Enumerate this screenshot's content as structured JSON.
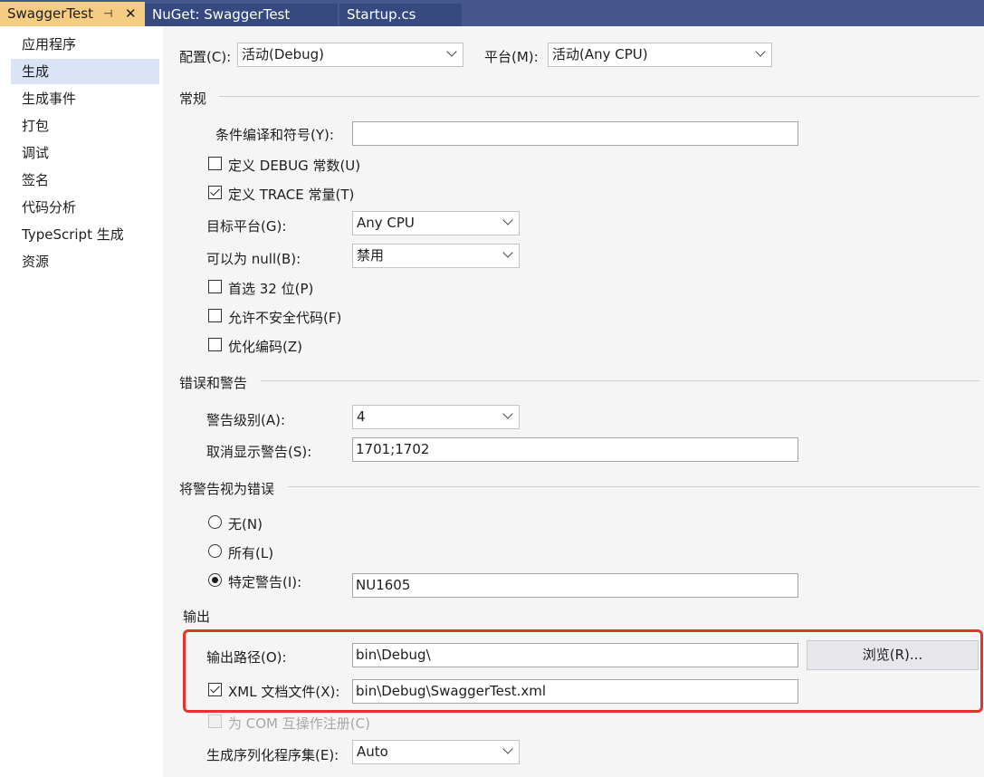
{
  "tabs": [
    {
      "label": "SwaggerTest",
      "pin": "⊣",
      "close": "✕"
    },
    {
      "label": "NuGet: SwaggerTest"
    },
    {
      "label": "Startup.cs"
    }
  ],
  "sidebar": {
    "items": [
      {
        "label": "应用程序"
      },
      {
        "label": "生成"
      },
      {
        "label": "生成事件"
      },
      {
        "label": "打包"
      },
      {
        "label": "调试"
      },
      {
        "label": "签名"
      },
      {
        "label": "代码分析"
      },
      {
        "label": "TypeScript 生成"
      },
      {
        "label": "资源"
      }
    ],
    "selected": "生成"
  },
  "header": {
    "config_label": "配置(C):",
    "config_value": "活动(Debug)",
    "platform_label": "平台(M):",
    "platform_value": "活动(Any CPU)"
  },
  "general": {
    "title": "常规",
    "symbols_label": "条件编译和符号(Y):",
    "symbols_value": "",
    "define_debug_label": "定义 DEBUG 常数(U)",
    "define_debug_checked": false,
    "define_trace_label": "定义 TRACE 常量(T)",
    "define_trace_checked": true,
    "target_label": "目标平台(G):",
    "target_value": "Any CPU",
    "nullable_label": "可以为 null(B):",
    "nullable_value": "禁用",
    "prefer32_label": "首选 32 位(P)",
    "unsafe_label": "允许不安全代码(F)",
    "optimize_label": "优化编码(Z)"
  },
  "errors": {
    "title": "错误和警告",
    "warning_level_label": "警告级别(A):",
    "warning_level_value": "4",
    "suppress_label": "取消显示警告(S):",
    "suppress_value": "1701;1702"
  },
  "treat_warnings": {
    "title": "将警告视为错误",
    "none_label": "无(N)",
    "all_label": "所有(L)",
    "specific_label": "特定警告(I):",
    "specific_value": "NU1605",
    "selected": "specific"
  },
  "output": {
    "title": "输出",
    "path_label": "输出路径(O):",
    "path_value": "bin\\Debug\\",
    "browse_label": "浏览(R)...",
    "xml_label": "XML 文档文件(X):",
    "xml_checked": true,
    "xml_value": "bin\\Debug\\SwaggerTest.xml",
    "com_label": "为 COM 互操作注册(C)",
    "serialization_label": "生成序列化程序集(E):",
    "serialization_value": "Auto"
  },
  "colors": {
    "tabbar": "#45578c",
    "active_tab": "#f5cc84",
    "sidebar_selected": "#dbe3f6",
    "highlight_border": "#e0342c"
  }
}
